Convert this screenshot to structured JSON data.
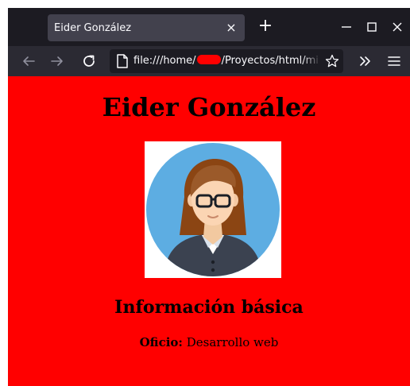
{
  "browser": {
    "tab_title": "Eider González",
    "tab_close_glyph": "×",
    "new_tab_glyph": "+",
    "url_prefix": "file:///home/",
    "url_suffix": "/Proyectos/html/mi",
    "icons": [
      "close-icon",
      "plus-icon",
      "minimize-icon",
      "maximize-icon",
      "window-close-icon",
      "back-arrow-icon",
      "forward-arrow-icon",
      "reload-icon",
      "page-icon",
      "bookmark-star-icon",
      "chevron-double-right-icon",
      "hamburger-menu-icon"
    ]
  },
  "page": {
    "title": "Eider González",
    "section_title": "Información básica",
    "info_label": "Oficio:",
    "info_value": "Desarrollo web",
    "background_color": "#ff0000"
  }
}
